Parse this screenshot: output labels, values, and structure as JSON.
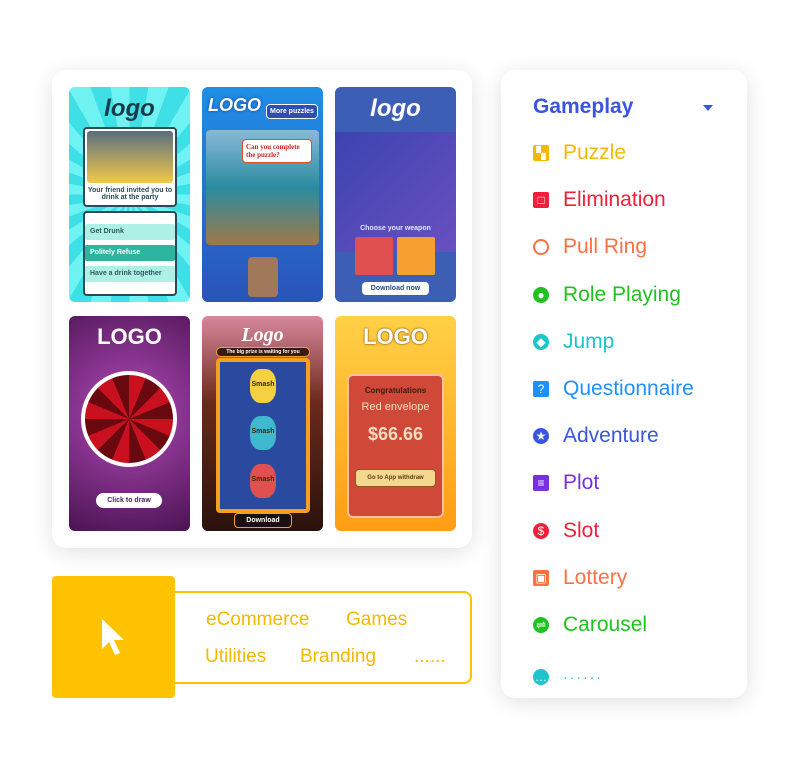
{
  "templates": [
    {
      "logo": "logo",
      "question": "Your friend invited you to drink at the party",
      "options": [
        "Get Drunk",
        "Politely Refuse",
        "Have a drink together"
      ]
    },
    {
      "logo": "LOGO",
      "button": "More puzzles",
      "bubble": "Can you complete the puzzle?"
    },
    {
      "logo": "logo",
      "caption": "Choose your weapon",
      "button": "Download now"
    },
    {
      "logo": "LOGO",
      "button": "Click to draw"
    },
    {
      "logo": "Logo",
      "banner": "The big prize is waiting for you",
      "eggs": [
        "Smash",
        "Smash",
        "Smash"
      ],
      "button": "Download"
    },
    {
      "logo": "LOGO",
      "title": "Congratulations",
      "subtitle": "Red envelope",
      "amount": "$66.66",
      "button": "Go to App withdraw"
    }
  ],
  "categories": [
    "eCommerce",
    "Games",
    "Utilities",
    "Branding",
    "......"
  ],
  "gameplay": {
    "title": "Gameplay",
    "items": [
      {
        "label": "Puzzle",
        "color": "#f5b800",
        "icon": "puzzle-icon"
      },
      {
        "label": "Elimination",
        "color": "#f0203a",
        "icon": "elimination-icon"
      },
      {
        "label": "Pull Ring",
        "color": "#ff7043",
        "icon": "pull-ring-icon"
      },
      {
        "label": "Role Playing",
        "color": "#1fc21f",
        "icon": "role-playing-icon"
      },
      {
        "label": "Jump",
        "color": "#1cc4cc",
        "icon": "jump-icon"
      },
      {
        "label": "Questionnaire",
        "color": "#1e90ff",
        "icon": "questionnaire-icon"
      },
      {
        "label": "Adventure",
        "color": "#3a55e0",
        "icon": "adventure-icon"
      },
      {
        "label": "Plot",
        "color": "#7a2fe0",
        "icon": "plot-icon"
      },
      {
        "label": "Slot",
        "color": "#f0203a",
        "icon": "slot-icon"
      },
      {
        "label": "Lottery",
        "color": "#ff7043",
        "icon": "lottery-icon"
      },
      {
        "label": "Carousel",
        "color": "#1fc21f",
        "icon": "carousel-icon"
      },
      {
        "label": "······",
        "color": "#1cc4cc",
        "icon": "more-icon"
      }
    ]
  },
  "colors": {
    "accent": "#ffc200",
    "title": "#3a55e0"
  }
}
